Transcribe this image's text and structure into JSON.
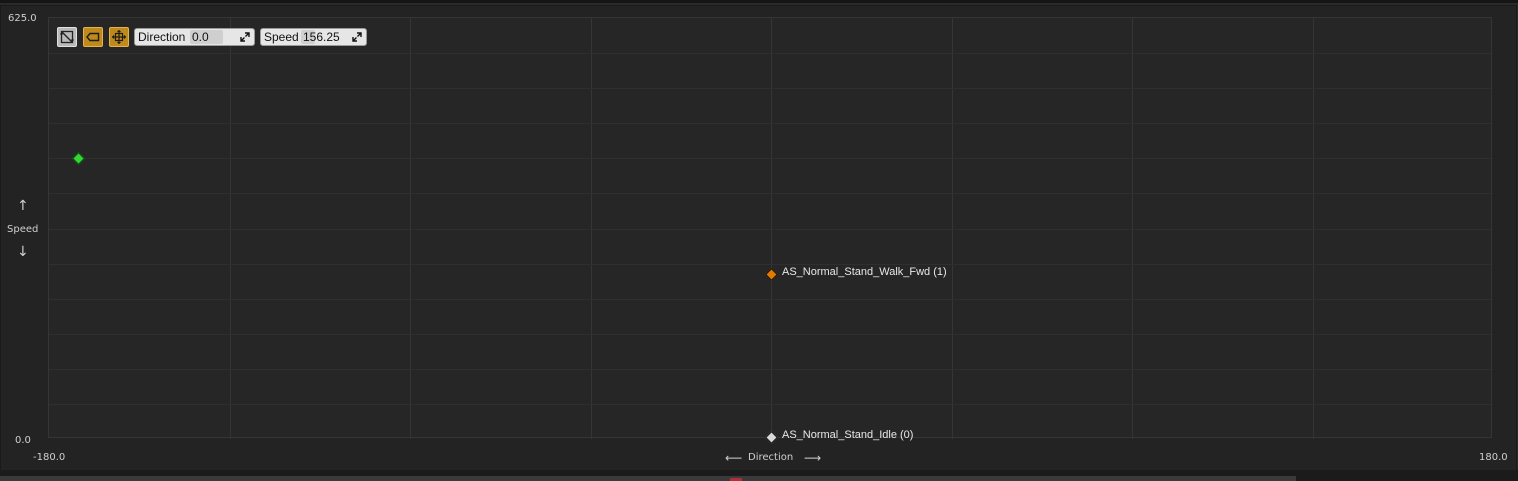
{
  "y_axis": {
    "max_label": "625.0",
    "min_label": "0.0",
    "name": "Speed",
    "up_arrow": "↑",
    "down_arrow": "↓"
  },
  "x_axis": {
    "min_label": "-180.0",
    "max_label": "180.0",
    "name": "Direction",
    "left_arrow": "⟵",
    "right_arrow": "⟶"
  },
  "toolbar": {
    "buttons": [
      {
        "icon": "snap-grid-icon",
        "state": "off"
      },
      {
        "icon": "label-tag-icon",
        "state": "on"
      },
      {
        "icon": "move-axes-icon",
        "state": "on"
      }
    ],
    "direction": {
      "label": "Direction",
      "value": "0.0"
    },
    "speed": {
      "label": "Speed",
      "value": "156.25"
    }
  },
  "samples": [
    {
      "name": "AS_Normal_Stand_Walk_Fwd (1)",
      "direction": 0.0,
      "speed": 243,
      "color": "#e07a00"
    },
    {
      "name": "AS_Normal_Stand_Idle (0)",
      "direction": 0.0,
      "speed": 0,
      "color": "#d8d8d8"
    }
  ],
  "preview_point": {
    "direction": -173,
    "speed": 415,
    "color": "#33d633"
  },
  "grid": {
    "columns": 8,
    "rows": 12
  },
  "colors": {
    "accent_orange": "#c08a1a",
    "background": "#262626"
  }
}
